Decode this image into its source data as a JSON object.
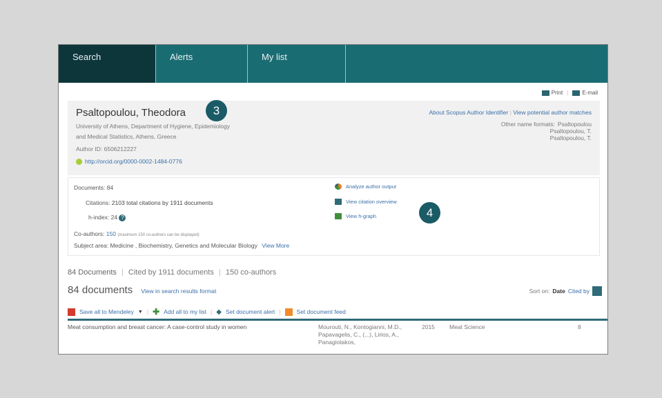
{
  "nav": {
    "tabs": [
      {
        "label": "Search"
      },
      {
        "label": "Alerts"
      },
      {
        "label": "My list"
      }
    ]
  },
  "utility": {
    "print": "Print",
    "email": "E-mail"
  },
  "profile": {
    "name": "Psaltopoulou, Theodora",
    "affiliation_line1": "University of Athens, Department of Hygiene, Epidemiology",
    "affiliation_line2": "and Medical Statistics, Athens, Greece",
    "author_id": "Author ID: 6506212227",
    "orcid_url": "http://orcid.org/0000-0002-1484-0776",
    "link_about": "About Scopus Author Identifier",
    "link_sep": "|",
    "link_matches": "View potential author matches",
    "other_names_label": "Other name formats:",
    "other_names": [
      "Psaltopoulou",
      "Psaltopoulou, T.",
      "Psaltopoulou, T."
    ]
  },
  "metrics": {
    "documents_label": "Documents:",
    "documents_value": "84",
    "citations_label": "Citations:",
    "citations_value": "2103 total citations by 1911 documents",
    "hindex_label": "h-index:",
    "hindex_value": "24",
    "coauthors_label": "Co-authors:",
    "coauthors_value": "150",
    "coauthors_note": "(maximum 150 co-authors can be displayed)",
    "subject_label": "Subject area:",
    "subject_value": "Medicine , Biochemistry, Genetics and Molecular Biology",
    "view_more": "View More",
    "actions": [
      {
        "label": "Analyze author output"
      },
      {
        "label": "View citation overview"
      },
      {
        "label": "View h-graph"
      }
    ]
  },
  "summary": {
    "documents": "84 Documents",
    "cited": "Cited by 1911 documents",
    "coauthors": "150 co-authors",
    "sep": "|"
  },
  "results": {
    "heading": "84 documents",
    "view_link": "View in search results format",
    "sort_label": "Sort on:",
    "sort_date": "Date",
    "sort_cited": "Cited by",
    "toolbar": {
      "save": "Save all to Mendeley",
      "add": "Add all to my list",
      "alert": "Set document alert",
      "feed": "Set document feed"
    },
    "rows": [
      {
        "title": "Meat consumption and breast cancer: A case-control study in women",
        "authors": "Mourouti, N., Kontogianni, M.D., Papavagelis, C., (...), Lirios, A., Panagiotakos,",
        "year": "2015",
        "source": "Meat Science",
        "cited": "8"
      }
    ]
  },
  "badges": {
    "three": "3",
    "four": "4"
  }
}
